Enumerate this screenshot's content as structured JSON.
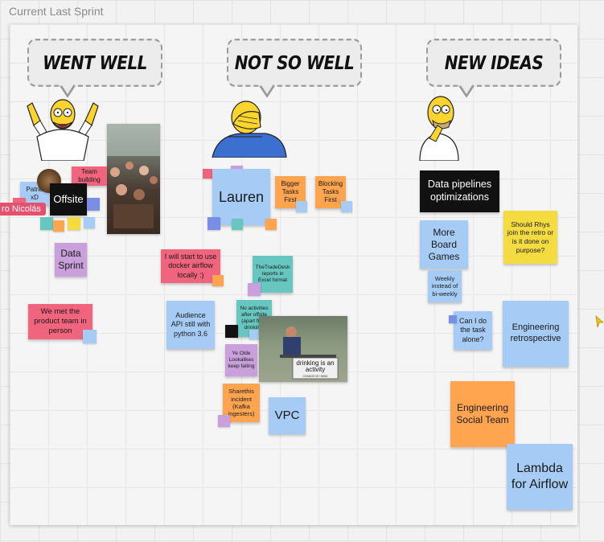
{
  "frame": {
    "title": "Current Last Sprint"
  },
  "columns": {
    "went_well": "WENT WELL",
    "not_so_well": "NOT SO WELL",
    "new_ideas": "NEW IDEAS"
  },
  "colors": {
    "pink": "#f1647d",
    "blue": "#a6ccf5",
    "purple": "#c9a0dc",
    "teal": "#67c6c0",
    "orange": "#ffa44f",
    "yellow": "#f4dc40",
    "black": "#111111"
  },
  "collaborator": {
    "name": "ro Nicolás"
  },
  "notes": {
    "patricio": "Patrio xD",
    "team_building": "Team building",
    "offsite": "Offsite",
    "data_sprint": "Data Sprint",
    "met_product": "We met the product team in person",
    "lauren": "Lauren",
    "bigger_tasks": "Bigger Tasks First",
    "blocking_tasks": "Blocking Tasks First",
    "docker_airflow": "I will start to use docker airflow locally :)",
    "tradedesk": "TheTradeDesk reports in Excel format",
    "audience_api": "Audience API still with python 3.6",
    "no_activities": "No activities after offsite (apart from drinking)",
    "ye_olde": "Ye Olde Lookalikes keep failing",
    "sharethis": "Sharethis incident (Kafka ingesters)",
    "vpc": "VPC",
    "data_pipelines": "Data pipelines optimizations",
    "more_board_games": "More Board Games",
    "weekly": "Weekly instead of bi-weekly",
    "should_rhys": "Should Rhys join the retro or is it done on purpose?",
    "can_i_do": "Can I do the task alone?",
    "eng_retro": "Engineering retrospective",
    "eng_social": "Engineering Social Team",
    "lambda": "Lambda for Airflow"
  },
  "meme": {
    "caption": "drinking is an activity",
    "sub": "CHANGE MY MIND"
  },
  "icons": {
    "went_well_homer": "homer-cheering-icon",
    "not_so_well_homer": "homer-facepalm-icon",
    "new_ideas_homer": "homer-thinking-icon",
    "cursor": "cursor-arrow-icon"
  }
}
